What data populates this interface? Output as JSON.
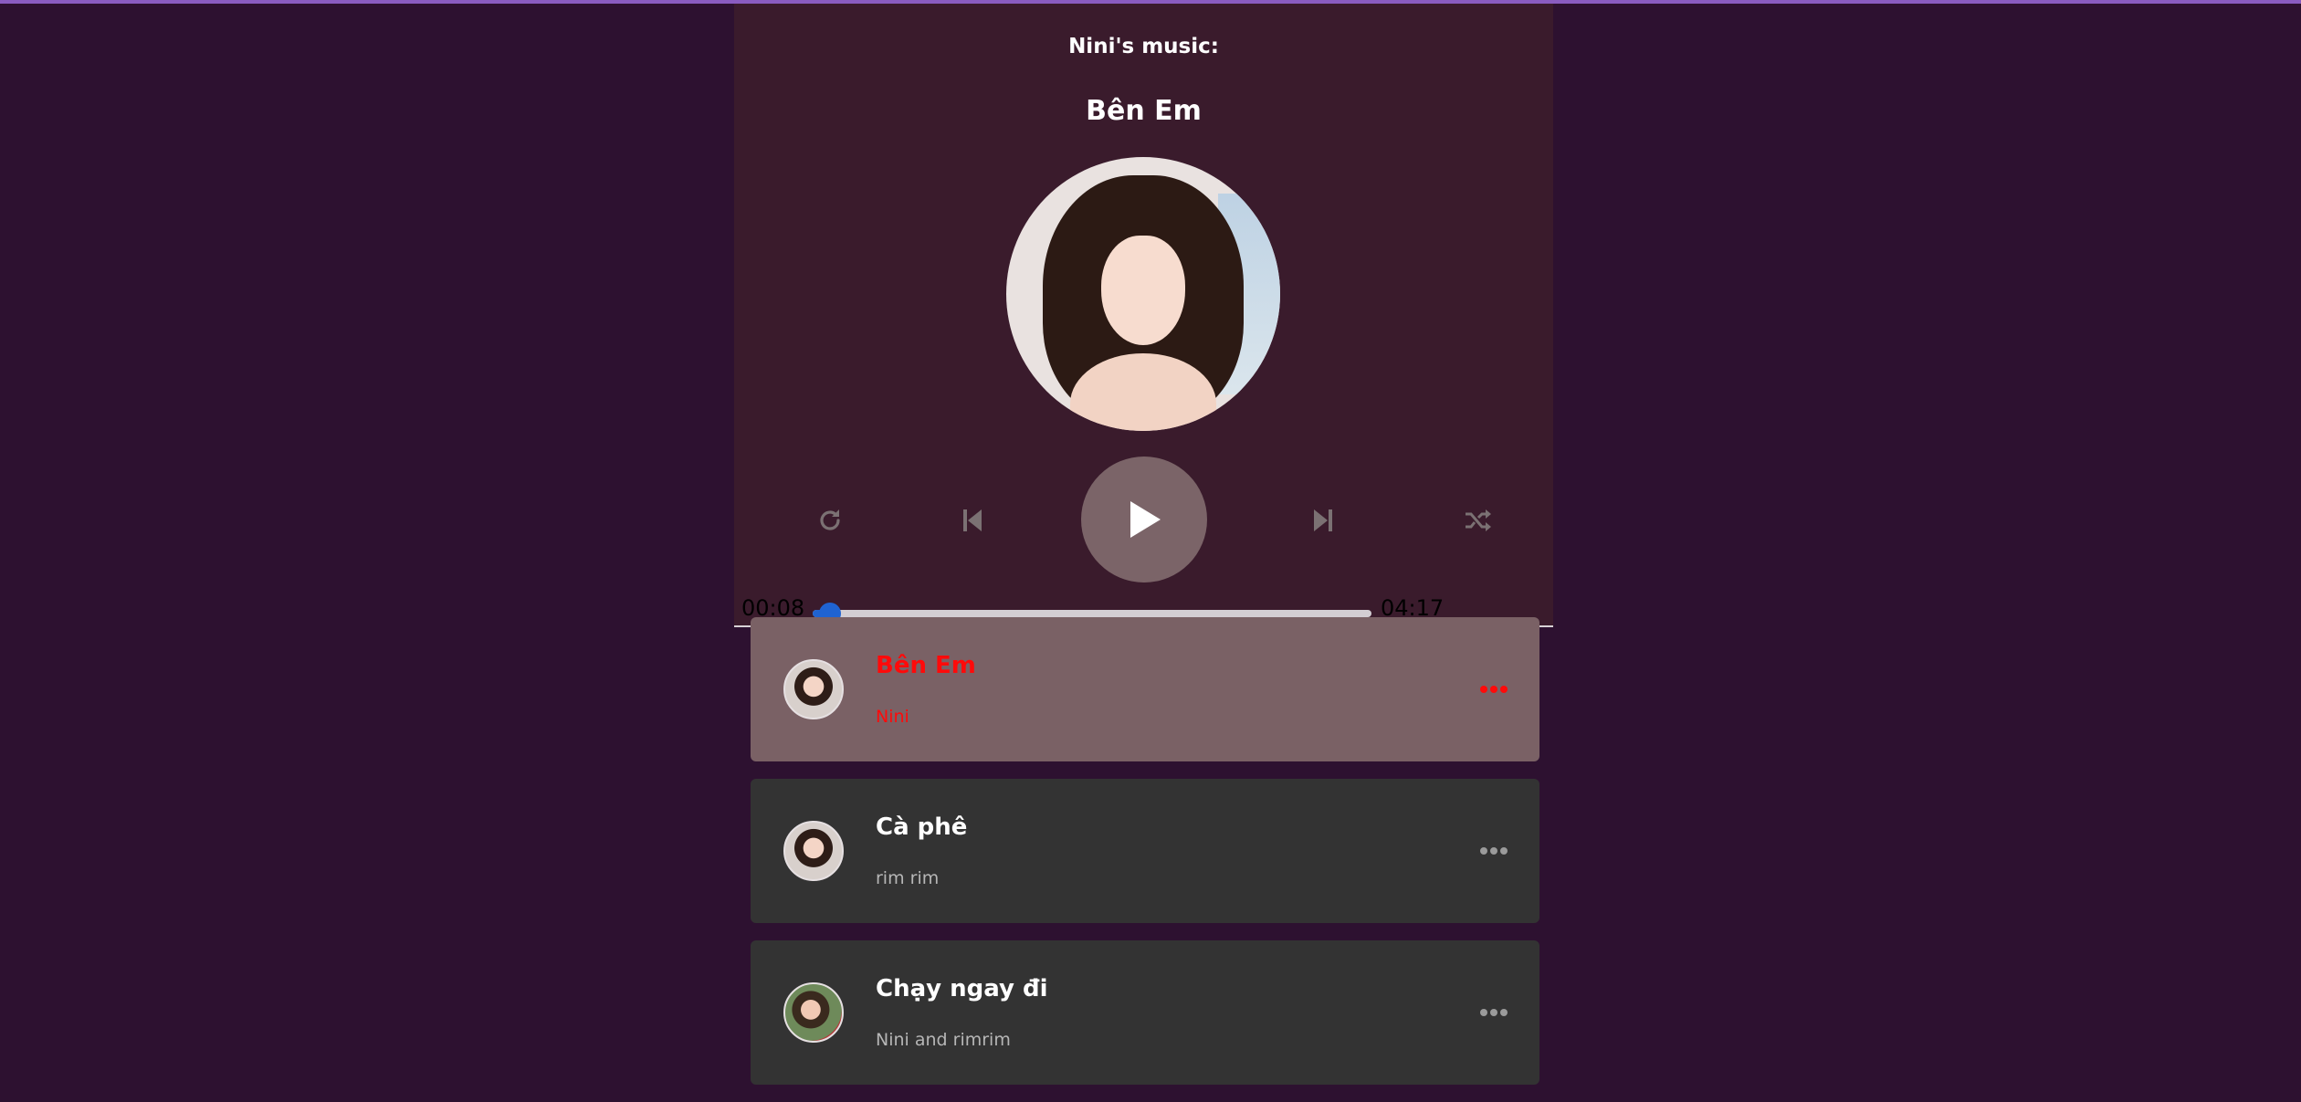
{
  "app": {
    "header_label": "Nini's music:",
    "current_title": "Bên Em"
  },
  "controls": {
    "repeat_icon": "repeat-icon",
    "prev_icon": "skip-back-icon",
    "play_icon": "play-icon",
    "next_icon": "skip-forward-icon",
    "random_icon": "shuffle-icon"
  },
  "progress": {
    "current_time": "00:08",
    "duration": "04:17",
    "fraction": 0.031
  },
  "playlist": [
    {
      "title": "Bên Em",
      "artist": "Nini",
      "active": true
    },
    {
      "title": "Cà phê",
      "artist": "rim rim",
      "active": false
    },
    {
      "title": "Chạy ngay đi",
      "artist": "Nini and rimrim",
      "active": false
    }
  ],
  "colors": {
    "background": "#2d1130",
    "player_bg": "#3a1b2c",
    "active_item_bg": "#7a6165",
    "item_bg": "#333333",
    "active_text": "#ff0a0a",
    "progress": "#1f63d1",
    "top_accent": "#8a5cc0"
  }
}
